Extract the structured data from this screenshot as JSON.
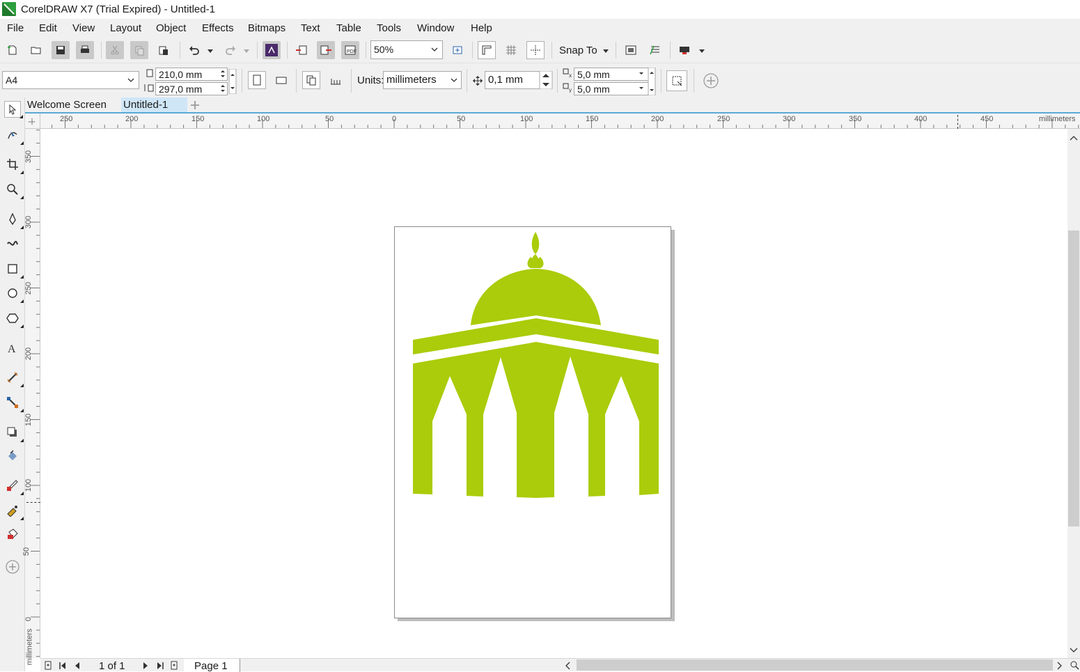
{
  "window": {
    "title": "CorelDRAW X7 (Trial Expired) - Untitled-1",
    "accent": "#2e9e3e"
  },
  "menu": [
    "File",
    "Edit",
    "View",
    "Layout",
    "Object",
    "Effects",
    "Bitmaps",
    "Text",
    "Table",
    "Tools",
    "Window",
    "Help"
  ],
  "toolbar": {
    "zoom": "50%",
    "snap_to": "Snap To",
    "icons": [
      "new-icon",
      "open-icon",
      "save-icon",
      "print-icon",
      "cut-icon",
      "copy-icon",
      "paste-icon",
      "undo-icon",
      "redo-icon",
      "search-content-icon",
      "import-icon",
      "export-icon",
      "publish-pdf-icon",
      "zoom-levels-icon",
      "rulers-icon",
      "grid-icon",
      "guidelines-icon",
      "options-icon",
      "application-launcher-icon",
      "welcome-icon"
    ]
  },
  "property_bar": {
    "page_size": "A4",
    "width": "210,0 mm",
    "height": "297,0 mm",
    "units_label": "Units:",
    "units": "millimeters",
    "nudge": "0,1 mm",
    "dup_x": "5,0 mm",
    "dup_y": "5,0 mm"
  },
  "tabs": [
    "Welcome Screen",
    "Untitled-1"
  ],
  "ruler": {
    "units": "millimeters",
    "h_ticks": [
      "250",
      "200",
      "150",
      "100",
      "50",
      "0",
      "50",
      "100",
      "150",
      "200",
      "250",
      "300",
      "350",
      "400",
      "450"
    ],
    "v_ticks": [
      "350",
      "300",
      "250",
      "200",
      "150",
      "100",
      "50",
      "0"
    ]
  },
  "tools": [
    "pick-tool-icon",
    "shape-tool-icon",
    "crop-tool-icon",
    "zoom-tool-icon",
    "freehand-tool-icon",
    "artistic-media-icon",
    "rectangle-tool-icon",
    "ellipse-tool-icon",
    "polygon-tool-icon",
    "text-tool-icon",
    "parallel-dimension-icon",
    "connector-tool-icon",
    "drop-shadow-icon",
    "transparency-icon",
    "color-eyedropper-icon",
    "interactive-fill-icon",
    "smart-fill-icon",
    "add-tool-icon"
  ],
  "drawing": {
    "fill": "#aacc0a"
  },
  "status": {
    "page_count": "1 of 1",
    "page_tab": "Page 1"
  }
}
